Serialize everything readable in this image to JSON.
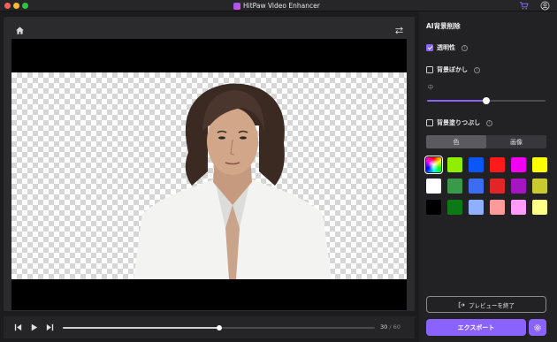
{
  "app": {
    "title": "HitPaw Video Enhancer"
  },
  "titlebar": {
    "icons": [
      "cart-icon",
      "user-icon"
    ]
  },
  "player": {
    "current_frame": "30",
    "total_frames": " / 60",
    "progress": 0.5
  },
  "panel": {
    "title": "AI背景削除",
    "options": [
      {
        "label": "透明性",
        "checked": true
      },
      {
        "label": "背景ぼかし",
        "checked": false
      },
      {
        "label": "背景塗りつぶし",
        "checked": false
      }
    ],
    "blur_level_label": "中",
    "blur_level": 0.5,
    "tabs": [
      {
        "label": "色",
        "active": true
      },
      {
        "label": "画像",
        "active": false
      }
    ],
    "swatches": [
      "rainbow",
      "#90ee02",
      "#0a57f5",
      "#ff1a1a",
      "#f200f2",
      "#ffff00",
      "#ffffff",
      "#3a9a4a",
      "#3c6cf0",
      "#e02626",
      "#a516c2",
      "#c9c930",
      "#000000",
      "#0c7a14",
      "#8fb0ff",
      "#ff9a9a",
      "#ff9aff",
      "#ffff88"
    ],
    "exit_preview_label": "プレビューを終了",
    "export_label": "エクスポート"
  },
  "colors": {
    "accent": "#8a63ff"
  }
}
